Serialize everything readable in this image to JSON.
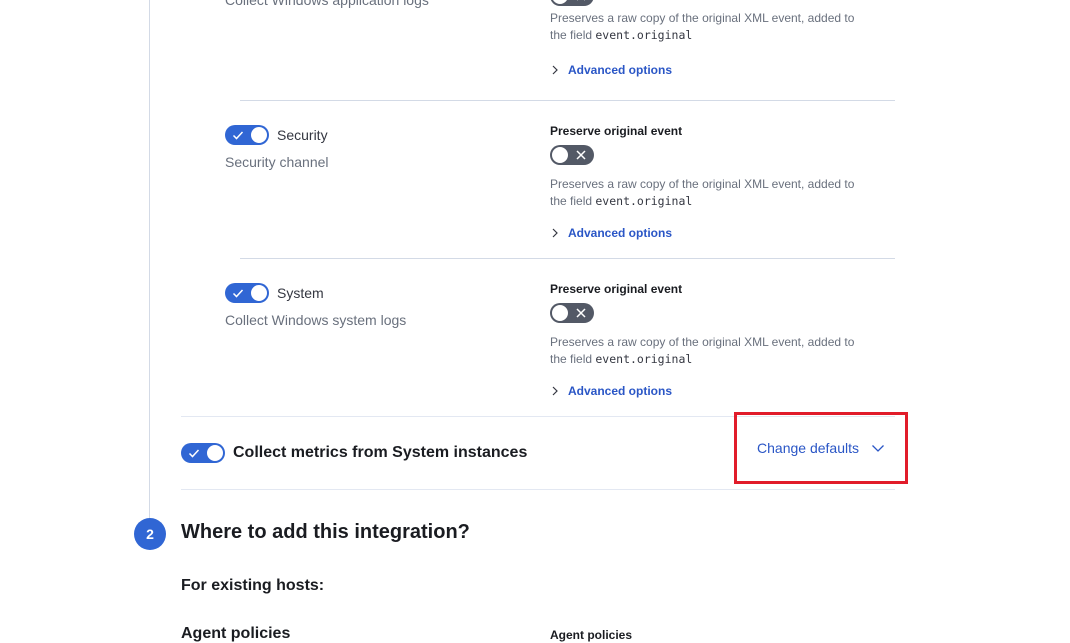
{
  "streams": [
    {
      "id": "application",
      "title": "",
      "enabled": true,
      "description": "Collect Windows application logs",
      "preserve_label": "",
      "preserve_enabled": false,
      "help_prefix": "Preserves a raw copy of the original XML event, added to",
      "help_field_prefix": "the field ",
      "help_field": "event.original",
      "advanced_label": "Advanced options"
    },
    {
      "id": "security",
      "title": "Security",
      "enabled": true,
      "description": "Security channel",
      "preserve_label": "Preserve original event",
      "preserve_enabled": false,
      "help_prefix": "Preserves a raw copy of the original XML event, added to",
      "help_field_prefix": "the field ",
      "help_field": "event.original",
      "advanced_label": "Advanced options"
    },
    {
      "id": "system",
      "title": "System",
      "enabled": true,
      "description": "Collect Windows system logs",
      "preserve_label": "Preserve original event",
      "preserve_enabled": false,
      "help_prefix": "Preserves a raw copy of the original XML event, added to",
      "help_field_prefix": "the field ",
      "help_field": "event.original",
      "advanced_label": "Advanced options"
    }
  ],
  "metrics": {
    "title": "Collect metrics from System instances",
    "enabled": true,
    "change_defaults_label": "Change defaults"
  },
  "step2": {
    "number": "2",
    "title": "Where to add this integration?",
    "existing_hosts_label": "For existing hosts:",
    "agent_policies_title": "Agent policies",
    "agent_policies_field_label": "Agent policies"
  },
  "colors": {
    "accent": "#3066d4",
    "link": "#2a56c6",
    "highlight_border": "#e11c2a",
    "switch_off": "#535966"
  },
  "icons": {
    "check": "check-icon",
    "cross": "cross-icon",
    "chevron_right": "chevron-right-icon",
    "chevron_down": "chevron-down-icon"
  }
}
